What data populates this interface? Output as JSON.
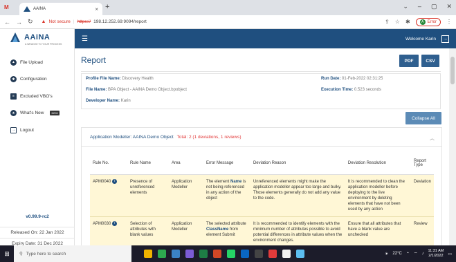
{
  "browser": {
    "tab_title": "AAINA",
    "tab_close": "×",
    "new_tab": "+",
    "not_secure": "Not secure",
    "url_scheme": "https://",
    "url_rest": "198.12.252.69:9094/report",
    "error_label": "Error",
    "avatar_initial": "A"
  },
  "sidebar": {
    "logo_text": "AAiNA",
    "logo_sub": "A WINDOW TO YOUR PROCESS",
    "items": [
      {
        "label": "File Upload",
        "icon": "cloud-upload-icon"
      },
      {
        "label": "Configuration",
        "icon": "gear-icon"
      },
      {
        "label": "Excluded VBO's",
        "icon": "document-icon"
      },
      {
        "label": "What's New",
        "icon": "star-icon",
        "badge": "NEW"
      },
      {
        "label": "Logout",
        "icon": "logout-icon"
      }
    ],
    "version": "v0.99.9-rc2",
    "released": "Released On: 22 Jan 2022",
    "expiry": "Expiry Date: 31 Dec 2022"
  },
  "header": {
    "welcome": "Welcome Karin"
  },
  "report": {
    "title": "Report",
    "pdf_label": "PDF",
    "csv_label": "CSV",
    "collapse_label": "Collapse All",
    "info": {
      "profile_label": "Profile File Name:",
      "profile_value": "Discovery Health",
      "file_label": "File Name:",
      "file_value": "BPA Object - AAINA Demo Object.bpobject",
      "developer_label": "Developer Name:",
      "developer_value": "Karin",
      "run_date_label": "Run Date:",
      "run_date_value": "01-Feb-2022 02:31:25",
      "exec_time_label": "Execution Time:",
      "exec_time_value": "0.523 seconds"
    },
    "panel": {
      "title": "Application Modeller: AAINA Demo Object",
      "total": "Total: 2 (1 deviations, 1 reviews)"
    },
    "columns": [
      "Rule No.",
      "Rule Name",
      "Area",
      "Error Message",
      "Deviation Reason",
      "Deviation Resolution",
      "Report Type"
    ],
    "rows": [
      {
        "rule_no": "APM0040",
        "rule_name": "Presence of unreferenced elements",
        "area": "Application Modeller",
        "msg_pre": "The element ",
        "msg_hl": "Name",
        "msg_post": " is not being referenced in any action of the object",
        "reason": "Unreferenced elements might make the application modeller appear too large and bulky. Those elements generally do not add any value to the code.",
        "resolution": "It is recommended to clean the application modeller before deploying to the live environment by deleting elements that have not been used by any action",
        "type": "Deviation"
      },
      {
        "rule_no": "APM0030",
        "rule_name": "Selection of attributes with blank values",
        "area": "Application Modeller",
        "msg_pre": "The selected attribute ",
        "msg_hl": "ClassName",
        "msg_post": " from element Submit",
        "reason": "It is recommended to identify elements with the minimum number of attributes possible to avoid potential differences in attribute values when the environment changes.",
        "resolution": "Ensure that all attributes that have a blank value are unchecked",
        "type": "Review"
      }
    ]
  },
  "taskbar": {
    "search_placeholder": "Type here to search",
    "temp": "22°C",
    "time": "11:31 AM",
    "date": "2/1/2022"
  },
  "colors": {
    "header_bg": "#1f4f7f",
    "button_bg": "#2f5f8f",
    "row_highlight": "#fff7d6",
    "total_red": "#e23b3b"
  }
}
